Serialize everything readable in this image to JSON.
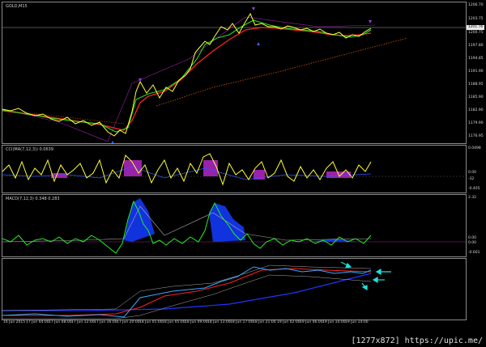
{
  "panes": {
    "main_label": "GOLD,M15",
    "cci_label": "CCI(MA(7,12,3)) 0.0639",
    "macd_label": "MACD(7,12,3) 0.348 0.283",
    "bottom_label": ""
  },
  "price_axis": [
    "1206.70",
    "1203.75",
    "1200.75",
    "1197.80",
    "1194.85",
    "1191.90",
    "1188.95",
    "1185.90",
    "1182.90",
    "1179.90",
    "1176.95"
  ],
  "current_price": "1201.76",
  "cci_axis": [
    "0.0498",
    "0.00",
    "-32",
    "-0.405"
  ],
  "macd_axis": [
    "2.32",
    "0.00",
    "0.00",
    "-0.601"
  ],
  "time_axis": [
    "16 Jun 2015",
    "17 Jun 04:00",
    "17 Jun 08:00",
    "17 Jun 12:00",
    "17 Jun 16:00",
    "17 Jun 20:00",
    "18 Jun 01:00",
    "18 Jun 05:00",
    "18 Jun 09:00",
    "18 Jun 13:00",
    "18 Jun 17:00",
    "18 Jun 21:00",
    "19 Jun 02:00",
    "19 Jun 06:00",
    "19 Jun 10:00",
    "19 Jun 14:00"
  ],
  "watermark": "[1277x872] https://upic.me/",
  "colors": {
    "price_line": "#ffff33",
    "fast_ma": "#22dd22",
    "slow_ma": "#ff2222",
    "trend_dotted": "#cc5500",
    "cci_line": "#ffff33",
    "histogram": "#9922aa",
    "macd_line": "#22ee22",
    "macd_fill": "#1133dd",
    "bottom_line": "#33aaff",
    "arrow_marker": "#22dddd"
  }
}
